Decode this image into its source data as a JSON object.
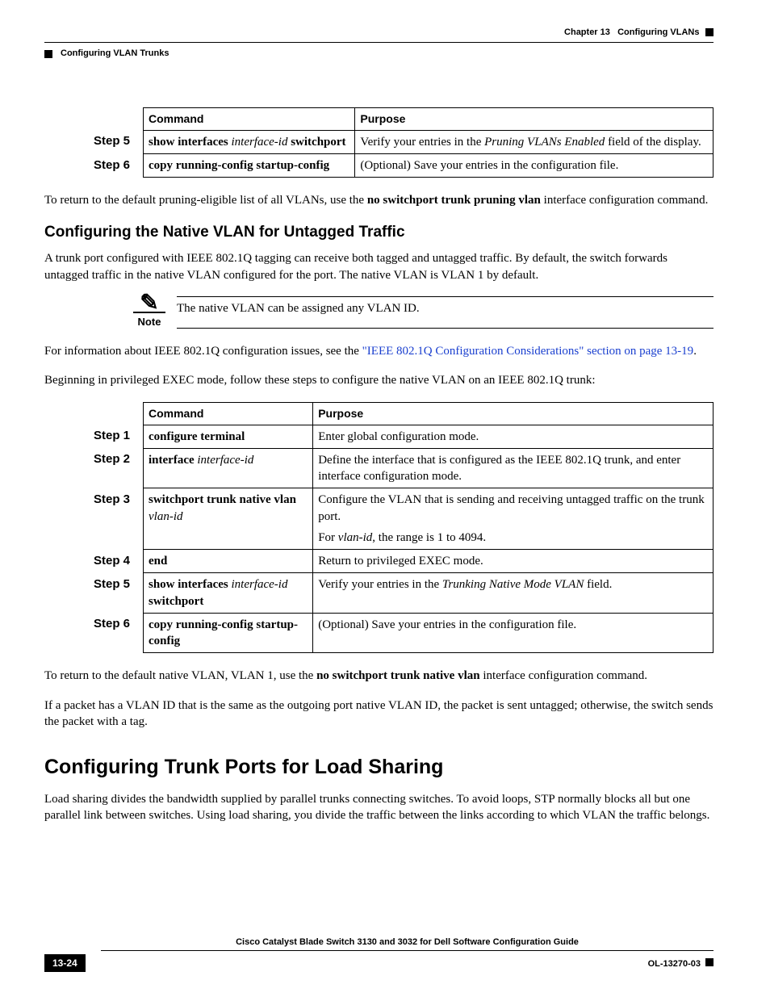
{
  "header": {
    "chapter_label": "Chapter 13",
    "chapter_title": "Configuring VLANs",
    "section_title": "Configuring VLAN Trunks"
  },
  "table1": {
    "col_command": "Command",
    "col_purpose": "Purpose",
    "rows": [
      {
        "step": "Step 5",
        "cmd_b1": "show interfaces ",
        "cmd_i1": "interface-id ",
        "cmd_b2": "switchport",
        "purpose_pre": "Verify your entries in the ",
        "purpose_i": "Pruning VLANs Enabled",
        "purpose_post": " field of the display."
      },
      {
        "step": "Step 6",
        "cmd_b1": "copy running-config startup-config",
        "cmd_i1": "",
        "cmd_b2": "",
        "purpose_pre": "(Optional) Save your entries in the configuration file.",
        "purpose_i": "",
        "purpose_post": ""
      }
    ]
  },
  "para_after_t1_pre": "To return to the default pruning-eligible list of all VLANs, use the ",
  "para_after_t1_b": "no switchport trunk pruning vlan",
  "para_after_t1_post": " interface configuration command.",
  "h2_native": "Configuring the Native VLAN for Untagged Traffic",
  "para_native_intro": "A trunk port configured with IEEE 802.1Q tagging can receive both tagged and untagged traffic. By default, the switch forwards untagged traffic in the native VLAN configured for the port. The native VLAN is VLAN 1 by default.",
  "note_label": "Note",
  "note_text": "The native VLAN can be assigned any VLAN ID.",
  "para_link_pre": "For information about IEEE 802.1Q configuration issues, see the ",
  "para_link_text": "\"IEEE 802.1Q Configuration Considerations\" section on page 13-19",
  "para_link_post": ".",
  "para_begin": "Beginning in privileged EXEC mode, follow these steps to configure the native VLAN on an IEEE 802.1Q trunk:",
  "table2": {
    "col_command": "Command",
    "col_purpose": "Purpose",
    "rows": [
      {
        "step": "Step 1",
        "cmd": "configure terminal",
        "cmd_i": "",
        "purpose": "Enter global configuration mode."
      },
      {
        "step": "Step 2",
        "cmd": "interface ",
        "cmd_i": "interface-id",
        "purpose": "Define the interface that is configured as the IEEE 802.1Q trunk, and enter interface configuration mode."
      },
      {
        "step": "Step 3",
        "cmd": "switchport trunk native vlan ",
        "cmd_i": "vlan-id",
        "purpose": "Configure the VLAN that is sending and receiving untagged traffic on the trunk port.",
        "purpose2_pre": "For ",
        "purpose2_i": "vlan-id",
        "purpose2_post": ", the range is 1 to 4094."
      },
      {
        "step": "Step 4",
        "cmd": "end",
        "cmd_i": "",
        "purpose": "Return to privileged EXEC mode."
      },
      {
        "step": "Step 5",
        "cmd": "show interfaces ",
        "cmd_i": "interface-id",
        "cmd_b2": " switchport",
        "purpose_pre": "Verify your entries in the ",
        "purpose_i": "Trunking Native Mode VLAN",
        "purpose_post": " field."
      },
      {
        "step": "Step 6",
        "cmd": "copy running-config startup-config",
        "cmd_i": "",
        "purpose": "(Optional) Save your entries in the configuration file."
      }
    ]
  },
  "para_return_native_pre": "To return to the default native VLAN, VLAN 1, use the ",
  "para_return_native_b": "no switchport trunk native vlan",
  "para_return_native_post": " interface configuration command.",
  "para_packet": "If a packet has a VLAN ID that is the same as the outgoing port native VLAN ID, the packet is sent untagged; otherwise, the switch sends the packet with a tag.",
  "h1_load": "Configuring Trunk Ports for Load Sharing",
  "para_load": "Load sharing divides the bandwidth supplied by parallel trunks connecting switches. To avoid loops, STP normally blocks all but one parallel link between switches. Using load sharing, you divide the traffic between the links according to which VLAN the traffic belongs.",
  "footer": {
    "guide": "Cisco Catalyst Blade Switch 3130 and 3032 for Dell Software Configuration Guide",
    "page": "13-24",
    "doc_id": "OL-13270-03"
  }
}
